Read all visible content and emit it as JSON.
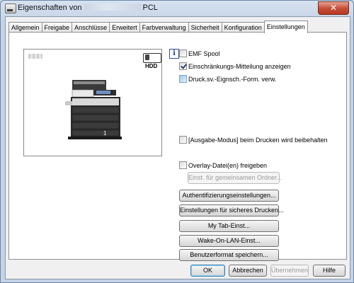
{
  "window": {
    "title_prefix": "Eigenschaften von",
    "title_suffix": "PCL",
    "close_symbol": "✕"
  },
  "tabs": [
    {
      "label": "Allgemein"
    },
    {
      "label": "Freigabe"
    },
    {
      "label": "Anschlüsse"
    },
    {
      "label": "Erweitert"
    },
    {
      "label": "Farbverwaltung"
    },
    {
      "label": "Sicherheit"
    },
    {
      "label": "Konfiguration"
    },
    {
      "label": "Einstellungen",
      "active": true
    }
  ],
  "preview": {
    "hdd_label": "HDD",
    "tray_number": "1"
  },
  "info_icon_glyph": "i",
  "options": {
    "emf_spool": {
      "label": "EMF Spool",
      "checked": false
    },
    "restriction_notice": {
      "label": "Einschränkungs-Mitteilung anzeigen",
      "checked": true
    },
    "print_form": {
      "label": "Druck.sv.-Eignsch.-Form. verw.",
      "checked": false
    },
    "output_mode": {
      "label": "[Ausgabe-Modus] beim Drucken wird beibehalten",
      "checked": false
    },
    "overlay_share": {
      "label": "Overlay-Datei(en) freigeben",
      "checked": false
    }
  },
  "buttons": {
    "shared_folder": "Einst. für gemeinsamen Ordner...",
    "auth_settings": "Authentifizierungseinstellungen...",
    "secure_print": "Einstellungen für sicheres Drucken...",
    "my_tab": "My Tab-Einst...",
    "wake_on_lan": "Wake-On-LAN-Einst...",
    "save_custom_format": "Benutzerformat speichern..."
  },
  "footer": {
    "ok": "OK",
    "cancel": "Abbrechen",
    "apply": "Übernehmen",
    "help": "Hilfe"
  },
  "colors": {
    "title_bar": "#c4d3e6",
    "close_button": "#c7503a",
    "accent_blue": "#3c7fb1"
  }
}
